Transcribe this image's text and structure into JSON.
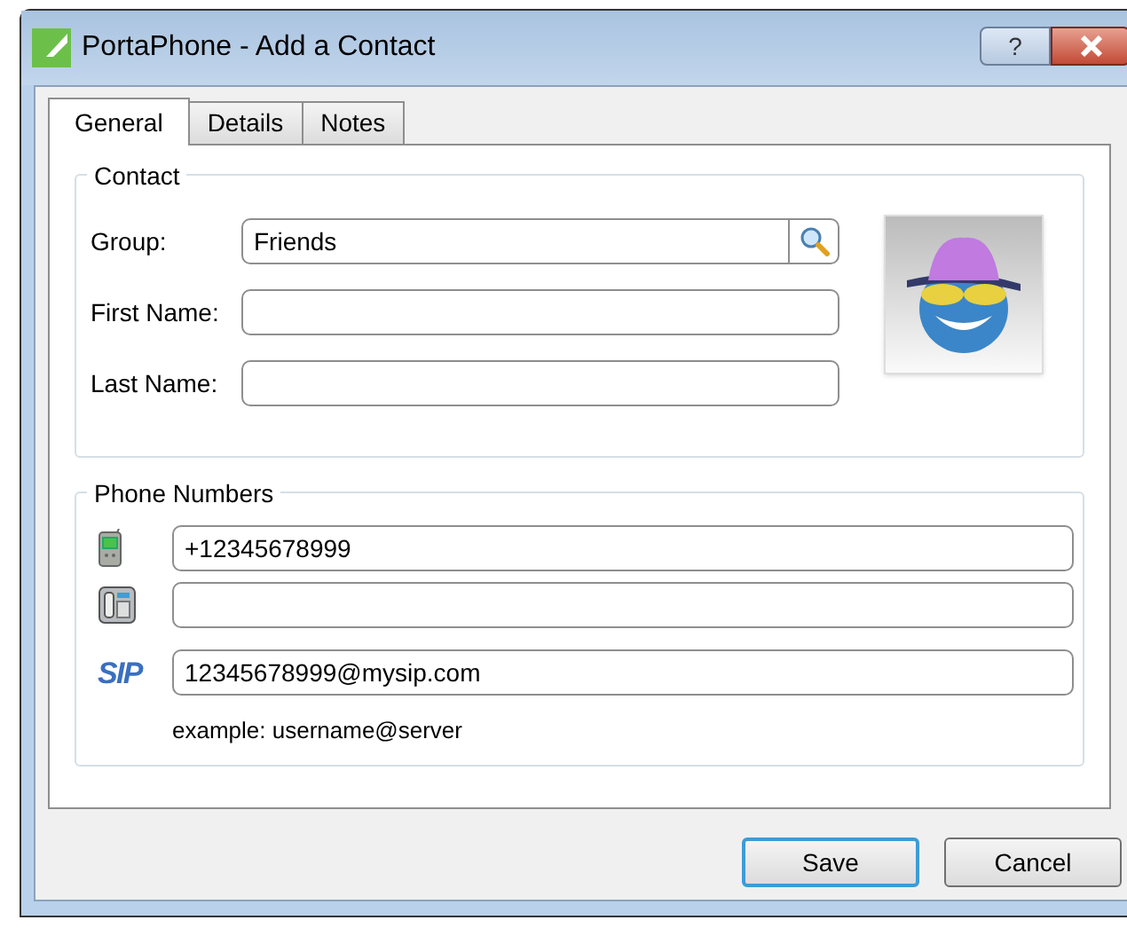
{
  "window": {
    "title": "PortaPhone - Add a Contact",
    "help_button": "?"
  },
  "tabs": [
    {
      "label": "General",
      "selected": true
    },
    {
      "label": "Details",
      "selected": false
    },
    {
      "label": "Notes",
      "selected": false
    }
  ],
  "contact": {
    "legend": "Contact",
    "fields": [
      {
        "label": "Group:",
        "value": "Friends",
        "kind": "lookup"
      },
      {
        "label": "First Name:",
        "kind": "text"
      },
      {
        "label": "Last Name:",
        "kind": "text"
      }
    ]
  },
  "phone_numbers": {
    "legend": "Phone Numbers",
    "rows": [
      {
        "kind": "mobile",
        "value": "+12345678999"
      },
      {
        "kind": "desk"
      },
      {
        "kind": "sip",
        "badge": "SIP",
        "value": "12345678999@mysip.com"
      }
    ],
    "hint": "example: username@server"
  },
  "buttons": [
    {
      "label": "Save",
      "focused": true
    },
    {
      "label": "Cancel",
      "focused": false
    }
  ]
}
